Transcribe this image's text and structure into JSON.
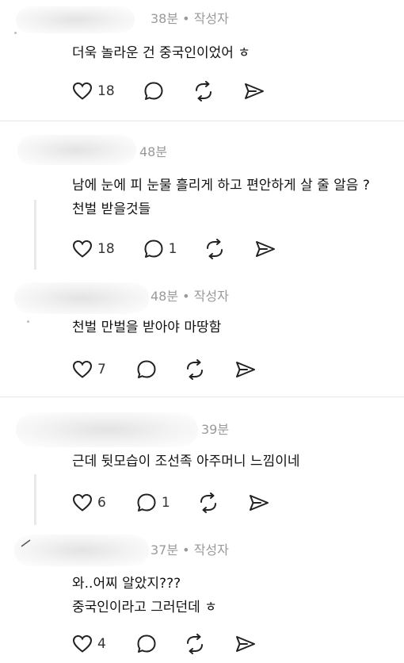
{
  "comments": [
    {
      "meta": "38분 • 작성자",
      "text": [
        "더욱 놀라운 건 중국인이었어 ㅎ"
      ],
      "likes": "18",
      "replies": ""
    },
    {
      "meta": "48분",
      "text": [
        "남에 눈에 피 눈물 흘리게 하고 편안하게 살 줄 알음 ?",
        "천벌 받을것들"
      ],
      "likes": "18",
      "replies": "1"
    },
    {
      "meta": "48분 • 작성자",
      "text": [
        "천벌 만벌을 받아야 마땅함"
      ],
      "likes": "7",
      "replies": ""
    },
    {
      "meta": "39분",
      "text": [
        "근데 뒷모습이 조선족 아주머니 느낌이네"
      ],
      "likes": "6",
      "replies": "1"
    },
    {
      "meta": "37분 • 작성자",
      "text": [
        "와..어찌 알았지???",
        "중국인이라고 그러던데 ㅎ"
      ],
      "likes": "4",
      "replies": ""
    }
  ],
  "icons": {
    "like": "heart-icon",
    "reply": "speech-bubble-icon",
    "repost": "repost-arrows-icon",
    "share": "send-arrow-icon"
  }
}
